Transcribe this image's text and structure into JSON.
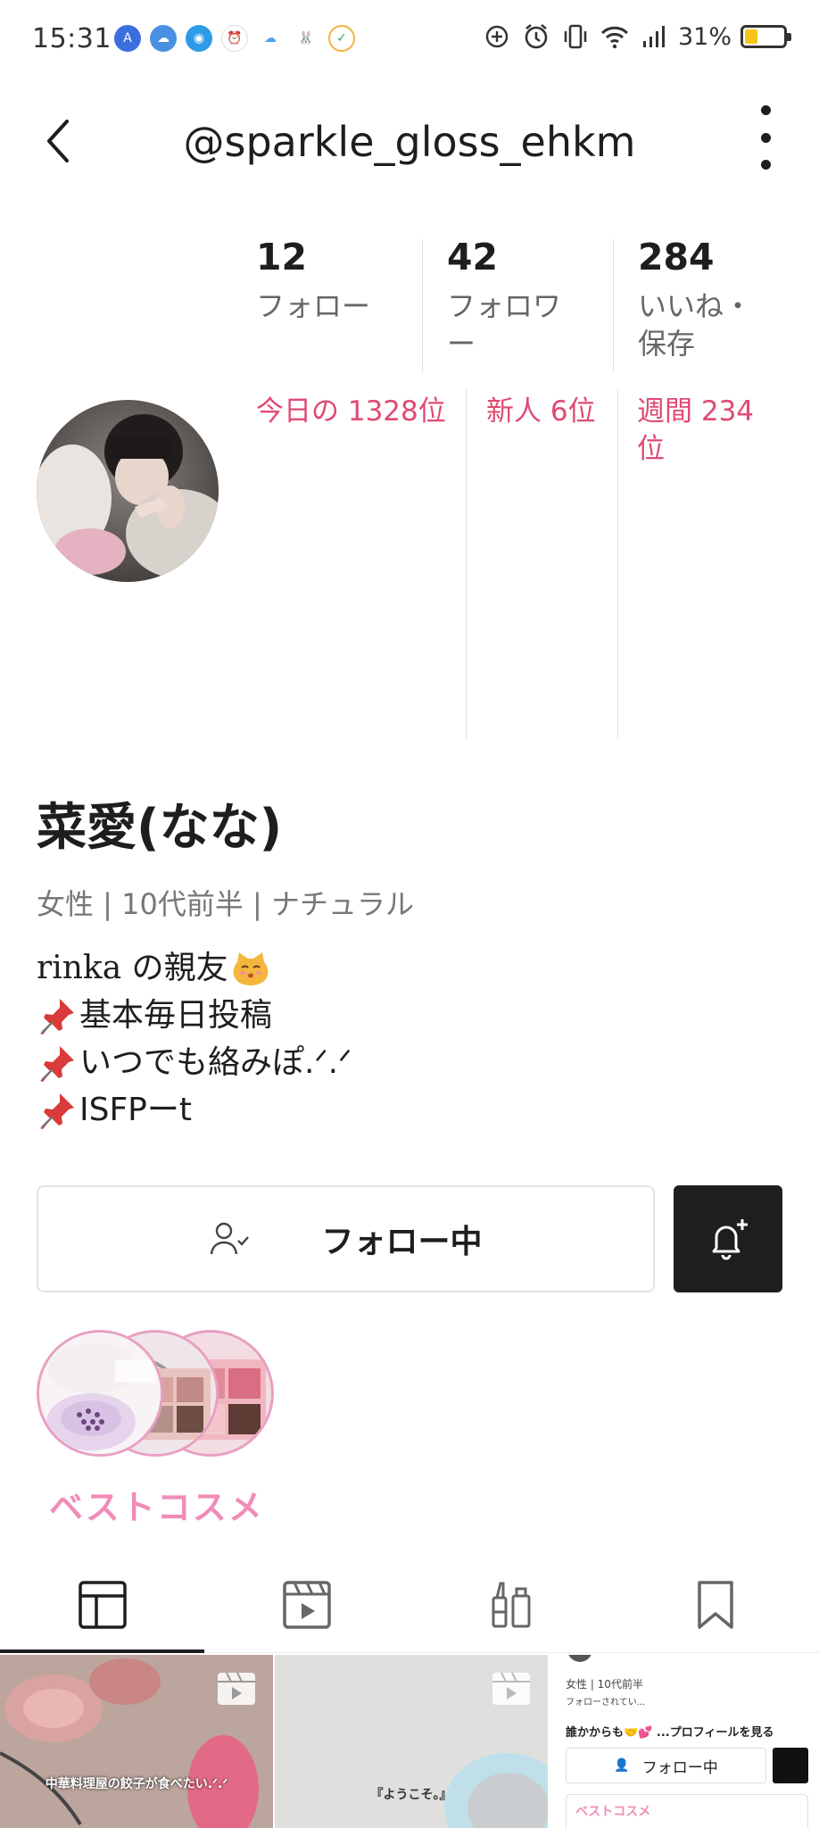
{
  "status_bar": {
    "time": "15:31",
    "battery_percent": "31%",
    "battery_level": 0.31,
    "icons": [
      "translate-icon",
      "weather-app-icon",
      "game-app-icon",
      "alarm-app-icon",
      "cloud-icon",
      "rabbit-app-icon",
      "check-app-icon",
      "add-circle-icon",
      "alarm-icon",
      "vibrate-icon",
      "wifi-icon",
      "signal-icon",
      "battery-icon"
    ]
  },
  "header": {
    "handle": "@sparkle_gloss_ehkm"
  },
  "stats": {
    "following": {
      "count": "12",
      "label": "フォロー"
    },
    "followers": {
      "count": "42",
      "label": "フォロワー"
    },
    "likes": {
      "count": "284",
      "label": "いいね・保存"
    }
  },
  "ranks": {
    "daily": "今日の 1328位",
    "newcomer": "新人 6位",
    "weekly": "週間 234位"
  },
  "profile": {
    "name": "菜愛(なな)",
    "meta": "女性 | 10代前半 | ナチュラル",
    "bio": [
      {
        "text": "rinka の親友",
        "icon": "cat-face-icon"
      },
      {
        "text": "基本毎日投稿",
        "icon": "pushpin-icon"
      },
      {
        "text": "いつでも絡みぽ.ᐟ.ᐟ",
        "icon": "pushpin-icon"
      },
      {
        "text": "ISFPーt",
        "icon": "pushpin-icon"
      }
    ]
  },
  "actions": {
    "follow_label": "フォロー中"
  },
  "highlight": {
    "label": "ベストコスメ"
  },
  "tabs": [
    "grid-icon",
    "video-icon",
    "cosme-icon",
    "bookmark-icon"
  ],
  "grid": {
    "post1_caption": "中華料理屋の餃子が食べたい.ᐟ.ᐟ",
    "post2_caption": "『ようこそ。』",
    "post3": {
      "meta": "女性 | 10代前半",
      "sub": "フォローされてい...",
      "cta": "誰かからも🤝💕 ...プロフィールを見る",
      "follow": "フォロー中",
      "cosme": "ベストコスメ"
    }
  },
  "colors": {
    "accent_pink": "#e04a72",
    "highlight_pink": "#f08cb8",
    "dark": "#1e1e1e"
  }
}
